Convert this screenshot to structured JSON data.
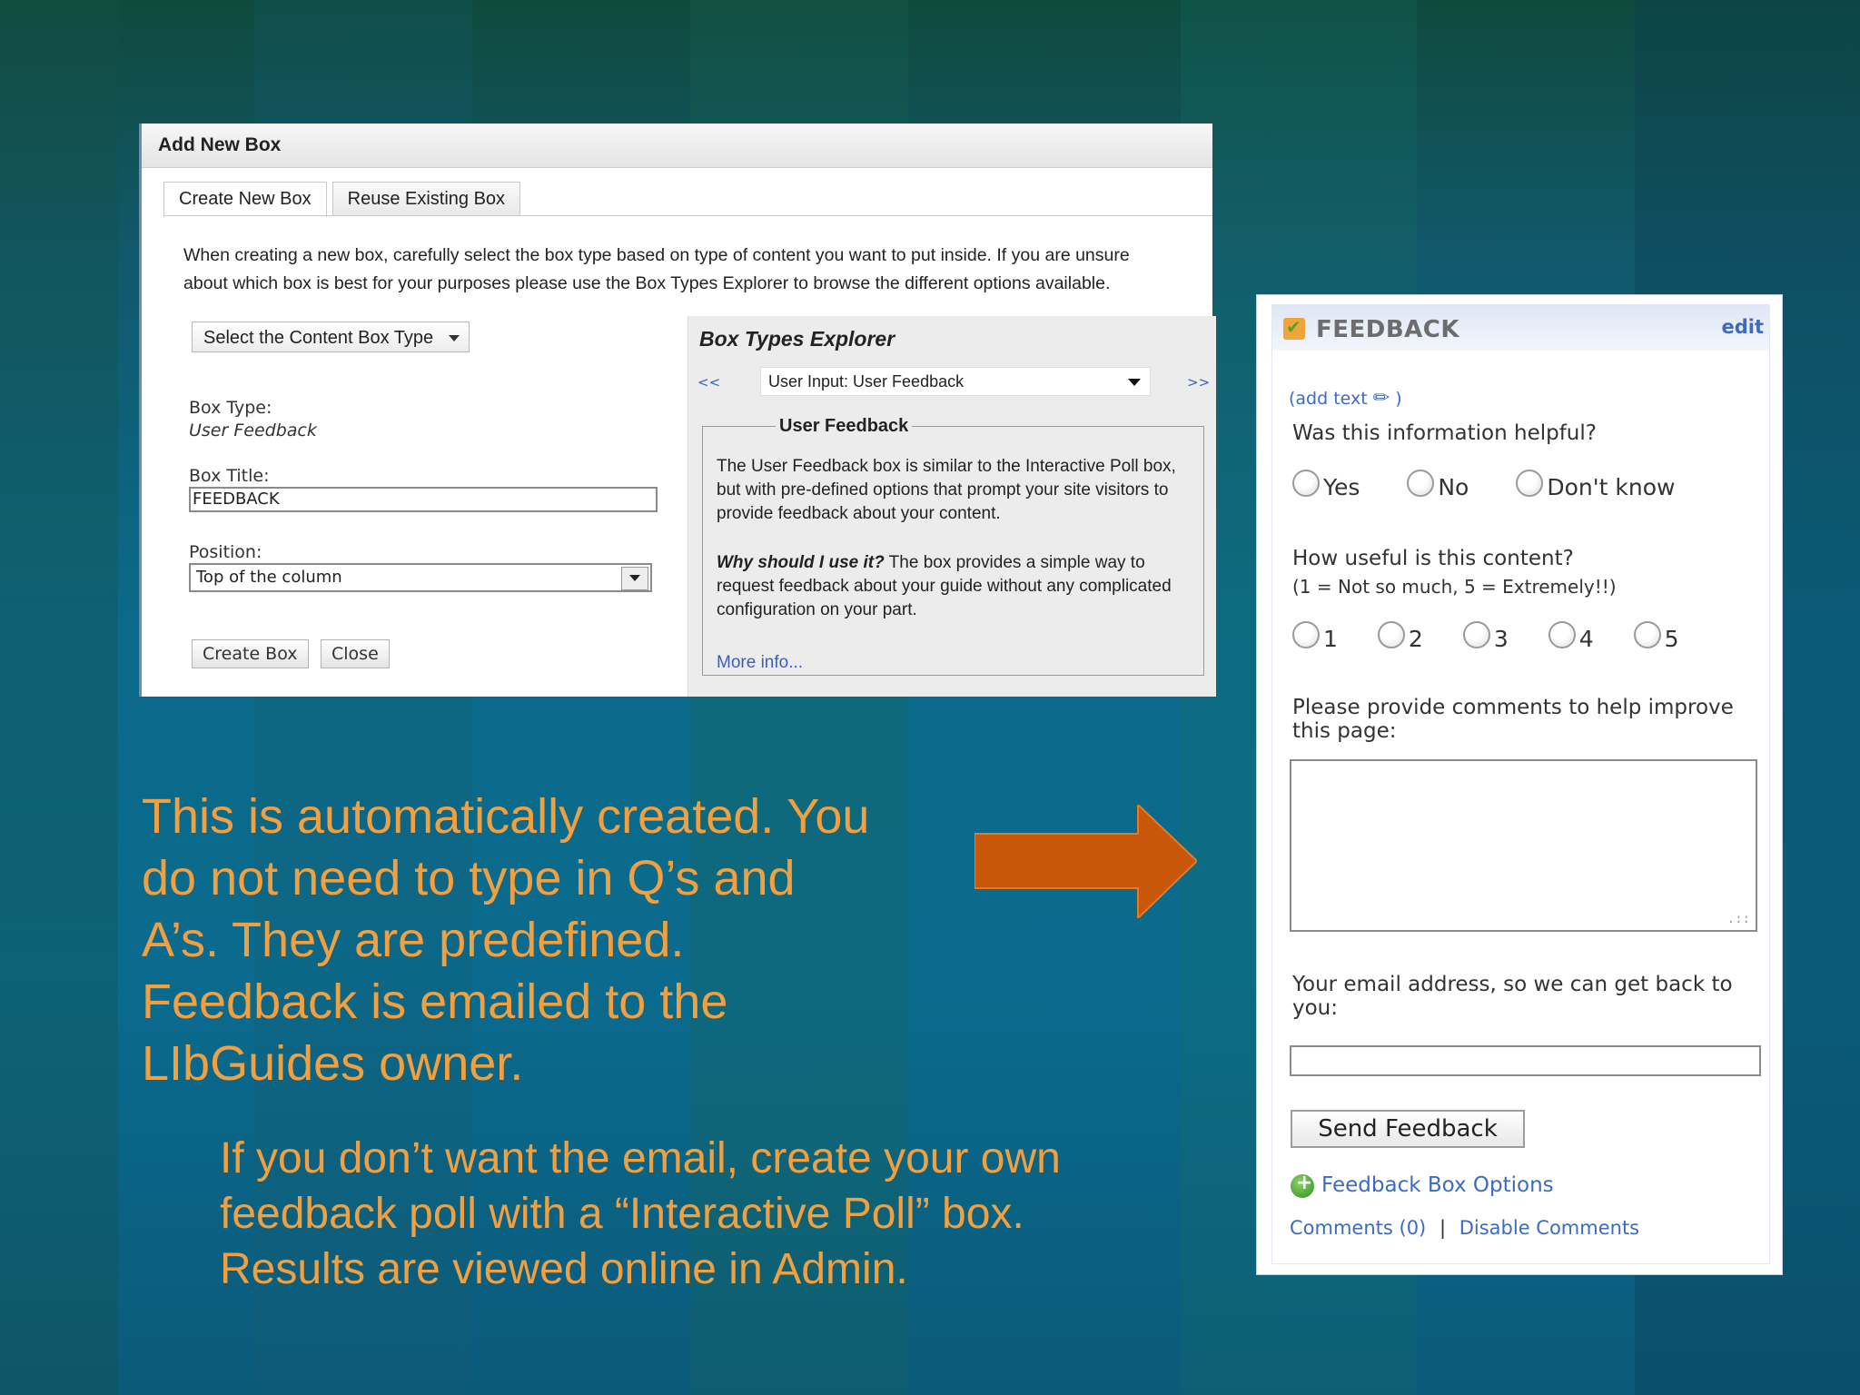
{
  "add_box": {
    "title": "Add New Box",
    "tabs": [
      "Create New Box",
      "Reuse Existing Box"
    ],
    "intro_line1": "When creating a new box, carefully select the box type based on type of content you want to put inside. If you are unsure",
    "intro_line2": "about which box is best for your purposes please use the Box Types Explorer to browse the different options available.",
    "select_type_label": "Select the Content Box Type",
    "box_type_label": "Box Type:",
    "box_type_value": "User Feedback",
    "box_title_label": "Box Title:",
    "box_title_value": "FEEDBACK",
    "position_label": "Position:",
    "position_value": "Top of the column",
    "create_button": "Create Box",
    "close_button": "Close",
    "explorer": {
      "heading": "Box Types Explorer",
      "prev": "<<",
      "next": ">>",
      "selected": "User Input: User Feedback",
      "legend": "User Feedback",
      "description": "The User Feedback box is similar to the Interactive Poll box, but with pre-defined options that prompt your site visitors to provide feedback about your content.",
      "why_label": "Why should I use it?",
      "why_text": " The box provides a simple way to request feedback about your guide without any complicated configuration on your part.",
      "more_info": "More info..."
    }
  },
  "slide": {
    "main_text": [
      "This is automatically created. You",
      "do not need to type in Q’s and",
      "A’s. They are predefined.",
      "Feedback is emailed to the",
      "LIbGuides owner."
    ],
    "sub_text": [
      "If you don’t want the email, create your own",
      "feedback poll with a “Interactive Poll” box.",
      "Results are viewed online in Admin."
    ],
    "arrow_color": "#c8570a",
    "text_color": "#f0a040"
  },
  "feedback": {
    "title": "FEEDBACK",
    "edit": "edit",
    "add_text": "(add text",
    "add_text_close": ")",
    "q1": "Was this information helpful?",
    "q1_options": [
      "Yes",
      "No",
      "Don't know"
    ],
    "q2": "How useful is this content?",
    "q2_scale": "(1 = Not so much, 5 = Extremely!!)",
    "q2_options": [
      "1",
      "2",
      "3",
      "4",
      "5"
    ],
    "comments_line1": "Please provide comments to help improve",
    "comments_line2": "this page:",
    "email_line1": "Your email address, so we can get back to",
    "email_line2": "you:",
    "send_button": "Send Feedback",
    "options_link": "Feedback Box Options",
    "comments_link": "Comments (0)",
    "separator": "|",
    "disable_link": "Disable Comments"
  }
}
